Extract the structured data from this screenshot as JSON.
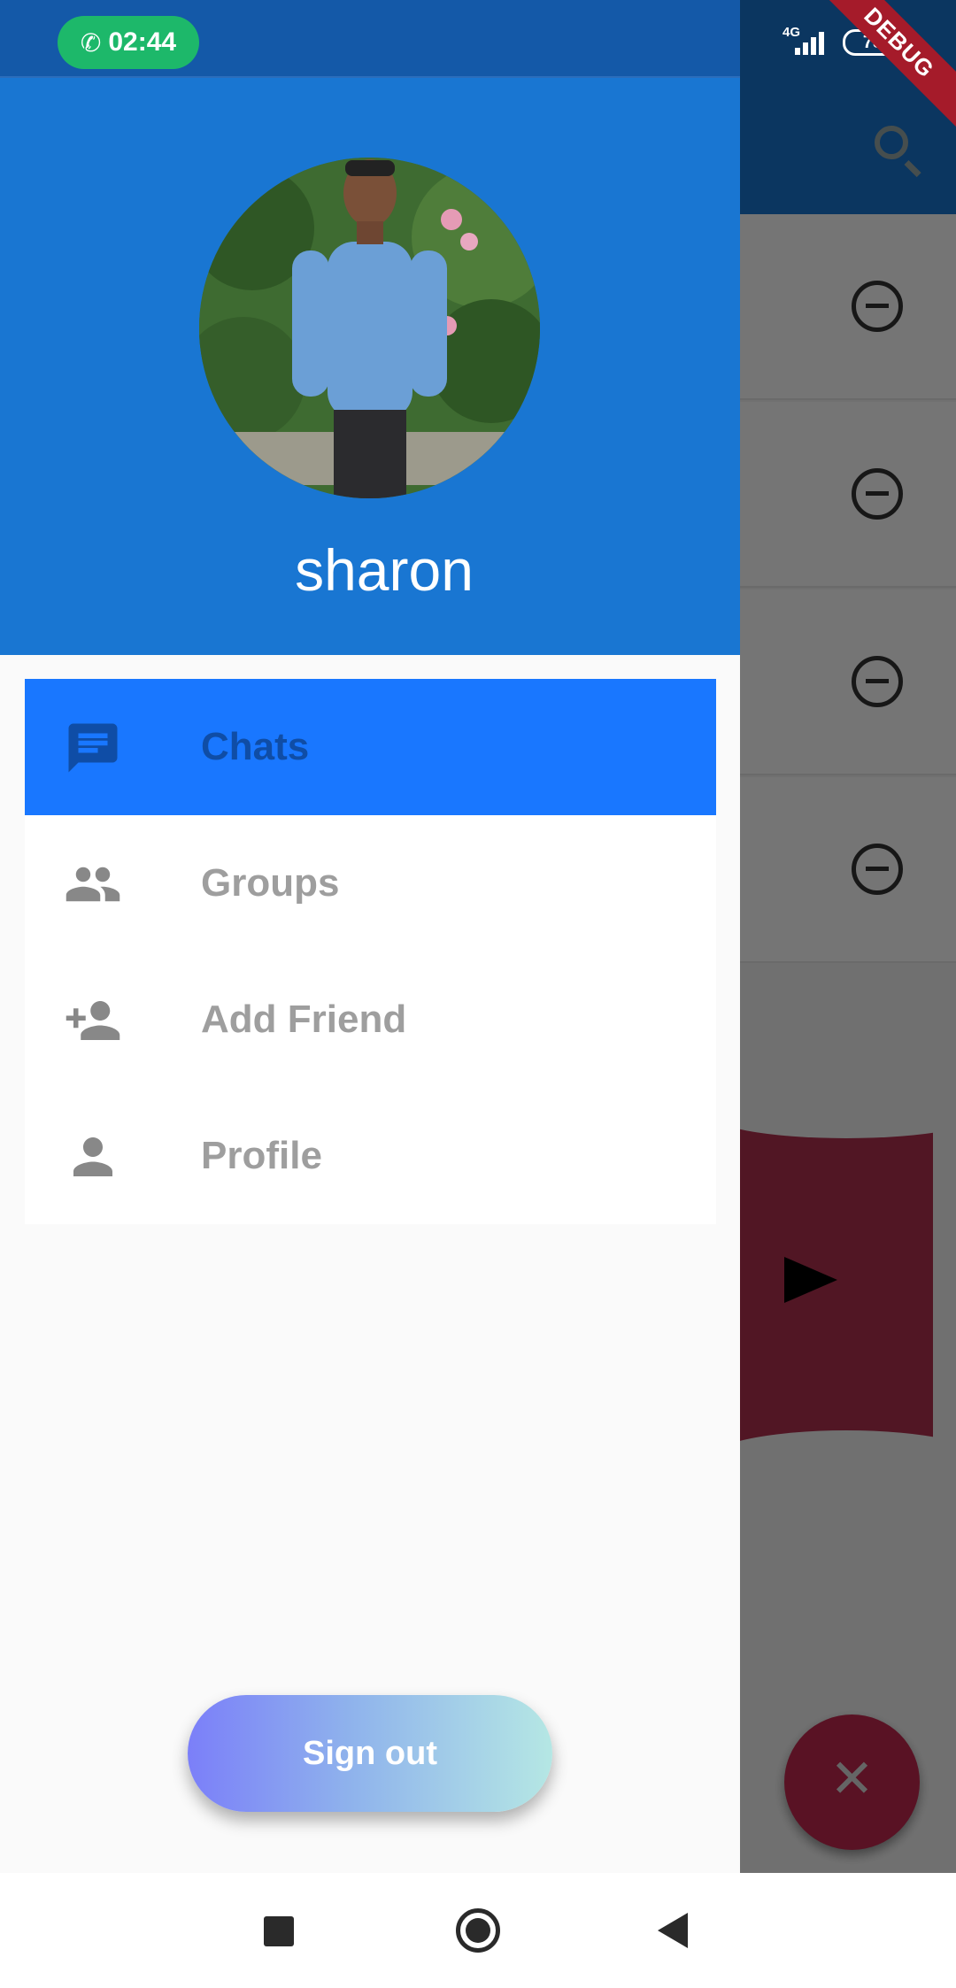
{
  "status_bar": {
    "call_time": "02:44",
    "network_type": "4G",
    "battery_level": "78",
    "debug_banner": "DEBUG"
  },
  "drawer": {
    "user_name": "sharon",
    "menu": [
      {
        "label": "Chats",
        "icon": "chat-icon",
        "active": true
      },
      {
        "label": "Groups",
        "icon": "groups-icon",
        "active": false
      },
      {
        "label": "Add Friend",
        "icon": "add-friend-icon",
        "active": false
      },
      {
        "label": "Profile",
        "icon": "profile-icon",
        "active": false
      }
    ],
    "sign_out_label": "Sign out"
  },
  "background_app": {
    "fab_icon": "close-icon",
    "send_icon": "send-icon",
    "search_icon": "search-icon"
  },
  "colors": {
    "primary": "#1976d2",
    "active_item": "#1977ff",
    "active_text": "#0f4da6",
    "inactive_text": "#9e9e9e",
    "call_pill": "#1db86a",
    "fab": "#c2294f"
  }
}
